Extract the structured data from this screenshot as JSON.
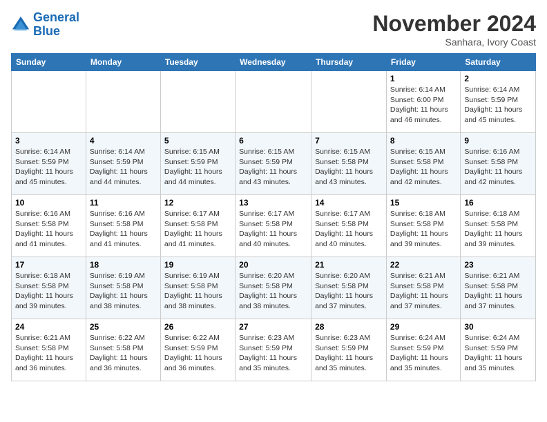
{
  "logo": {
    "line1": "General",
    "line2": "Blue"
  },
  "title": "November 2024",
  "subtitle": "Sanhara, Ivory Coast",
  "weekdays": [
    "Sunday",
    "Monday",
    "Tuesday",
    "Wednesday",
    "Thursday",
    "Friday",
    "Saturday"
  ],
  "weeks": [
    [
      {
        "day": "",
        "info": ""
      },
      {
        "day": "",
        "info": ""
      },
      {
        "day": "",
        "info": ""
      },
      {
        "day": "",
        "info": ""
      },
      {
        "day": "",
        "info": ""
      },
      {
        "day": "1",
        "info": "Sunrise: 6:14 AM\nSunset: 6:00 PM\nDaylight: 11 hours and 46 minutes."
      },
      {
        "day": "2",
        "info": "Sunrise: 6:14 AM\nSunset: 5:59 PM\nDaylight: 11 hours and 45 minutes."
      }
    ],
    [
      {
        "day": "3",
        "info": "Sunrise: 6:14 AM\nSunset: 5:59 PM\nDaylight: 11 hours and 45 minutes."
      },
      {
        "day": "4",
        "info": "Sunrise: 6:14 AM\nSunset: 5:59 PM\nDaylight: 11 hours and 44 minutes."
      },
      {
        "day": "5",
        "info": "Sunrise: 6:15 AM\nSunset: 5:59 PM\nDaylight: 11 hours and 44 minutes."
      },
      {
        "day": "6",
        "info": "Sunrise: 6:15 AM\nSunset: 5:59 PM\nDaylight: 11 hours and 43 minutes."
      },
      {
        "day": "7",
        "info": "Sunrise: 6:15 AM\nSunset: 5:58 PM\nDaylight: 11 hours and 43 minutes."
      },
      {
        "day": "8",
        "info": "Sunrise: 6:15 AM\nSunset: 5:58 PM\nDaylight: 11 hours and 42 minutes."
      },
      {
        "day": "9",
        "info": "Sunrise: 6:16 AM\nSunset: 5:58 PM\nDaylight: 11 hours and 42 minutes."
      }
    ],
    [
      {
        "day": "10",
        "info": "Sunrise: 6:16 AM\nSunset: 5:58 PM\nDaylight: 11 hours and 41 minutes."
      },
      {
        "day": "11",
        "info": "Sunrise: 6:16 AM\nSunset: 5:58 PM\nDaylight: 11 hours and 41 minutes."
      },
      {
        "day": "12",
        "info": "Sunrise: 6:17 AM\nSunset: 5:58 PM\nDaylight: 11 hours and 41 minutes."
      },
      {
        "day": "13",
        "info": "Sunrise: 6:17 AM\nSunset: 5:58 PM\nDaylight: 11 hours and 40 minutes."
      },
      {
        "day": "14",
        "info": "Sunrise: 6:17 AM\nSunset: 5:58 PM\nDaylight: 11 hours and 40 minutes."
      },
      {
        "day": "15",
        "info": "Sunrise: 6:18 AM\nSunset: 5:58 PM\nDaylight: 11 hours and 39 minutes."
      },
      {
        "day": "16",
        "info": "Sunrise: 6:18 AM\nSunset: 5:58 PM\nDaylight: 11 hours and 39 minutes."
      }
    ],
    [
      {
        "day": "17",
        "info": "Sunrise: 6:18 AM\nSunset: 5:58 PM\nDaylight: 11 hours and 39 minutes."
      },
      {
        "day": "18",
        "info": "Sunrise: 6:19 AM\nSunset: 5:58 PM\nDaylight: 11 hours and 38 minutes."
      },
      {
        "day": "19",
        "info": "Sunrise: 6:19 AM\nSunset: 5:58 PM\nDaylight: 11 hours and 38 minutes."
      },
      {
        "day": "20",
        "info": "Sunrise: 6:20 AM\nSunset: 5:58 PM\nDaylight: 11 hours and 38 minutes."
      },
      {
        "day": "21",
        "info": "Sunrise: 6:20 AM\nSunset: 5:58 PM\nDaylight: 11 hours and 37 minutes."
      },
      {
        "day": "22",
        "info": "Sunrise: 6:21 AM\nSunset: 5:58 PM\nDaylight: 11 hours and 37 minutes."
      },
      {
        "day": "23",
        "info": "Sunrise: 6:21 AM\nSunset: 5:58 PM\nDaylight: 11 hours and 37 minutes."
      }
    ],
    [
      {
        "day": "24",
        "info": "Sunrise: 6:21 AM\nSunset: 5:58 PM\nDaylight: 11 hours and 36 minutes."
      },
      {
        "day": "25",
        "info": "Sunrise: 6:22 AM\nSunset: 5:58 PM\nDaylight: 11 hours and 36 minutes."
      },
      {
        "day": "26",
        "info": "Sunrise: 6:22 AM\nSunset: 5:59 PM\nDaylight: 11 hours and 36 minutes."
      },
      {
        "day": "27",
        "info": "Sunrise: 6:23 AM\nSunset: 5:59 PM\nDaylight: 11 hours and 35 minutes."
      },
      {
        "day": "28",
        "info": "Sunrise: 6:23 AM\nSunset: 5:59 PM\nDaylight: 11 hours and 35 minutes."
      },
      {
        "day": "29",
        "info": "Sunrise: 6:24 AM\nSunset: 5:59 PM\nDaylight: 11 hours and 35 minutes."
      },
      {
        "day": "30",
        "info": "Sunrise: 6:24 AM\nSunset: 5:59 PM\nDaylight: 11 hours and 35 minutes."
      }
    ]
  ]
}
